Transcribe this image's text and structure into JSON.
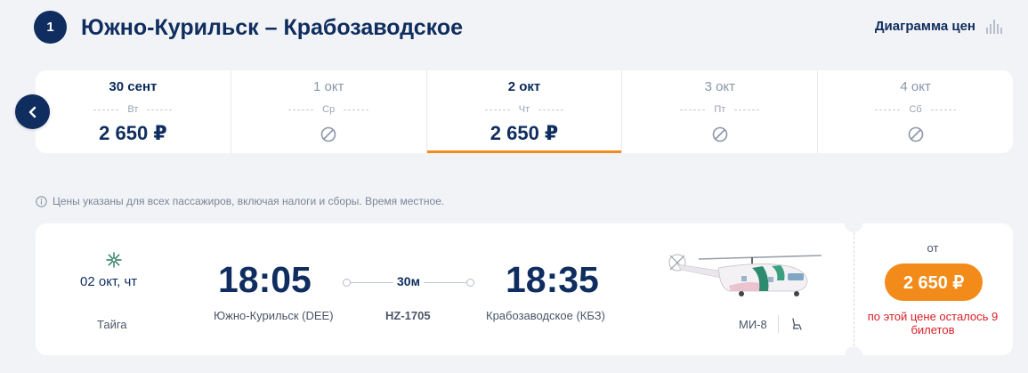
{
  "header": {
    "step": "1",
    "route_title": "Южно-Курильск – Крабозаводское",
    "price_diagram_label": "Диаграмма цен"
  },
  "carousel": {
    "days": [
      {
        "date": "30 сент",
        "weekday": "Вт",
        "price": "2 650 ₽",
        "available": true,
        "selected": false
      },
      {
        "date": "1 окт",
        "weekday": "Ср",
        "price": "",
        "available": false,
        "selected": false
      },
      {
        "date": "2 окт",
        "weekday": "Чт",
        "price": "2 650 ₽",
        "available": true,
        "selected": true
      },
      {
        "date": "3 окт",
        "weekday": "Пт",
        "price": "",
        "available": false,
        "selected": false
      },
      {
        "date": "4 окт",
        "weekday": "Сб",
        "price": "",
        "available": false,
        "selected": false
      }
    ]
  },
  "info_note": "Цены указаны для всех пассажиров, включая налоги и сборы. Время местное.",
  "flight": {
    "date": "02 окт, чт",
    "airline": "Тайга",
    "departure_time": "18:05",
    "departure_city": "Южно-Курильск (DEE)",
    "duration": "30м",
    "flight_number": "HZ-1705",
    "arrival_time": "18:35",
    "arrival_city": "Крабозаводское (КБЗ)",
    "aircraft": "МИ-8",
    "price_from_label": "от",
    "price": "2 650 ₽",
    "seats_left": "по этой цене осталось 9 билетов"
  },
  "colors": {
    "accent_orange": "#f28b1a",
    "navy": "#0f2d5e",
    "warning_red": "#d81f26"
  },
  "icons": [
    "chevron-left-icon",
    "info-icon",
    "bar-chart-icon",
    "unavailable-icon",
    "airline-logo-icon",
    "seat-icon",
    "helicopter-image"
  ]
}
